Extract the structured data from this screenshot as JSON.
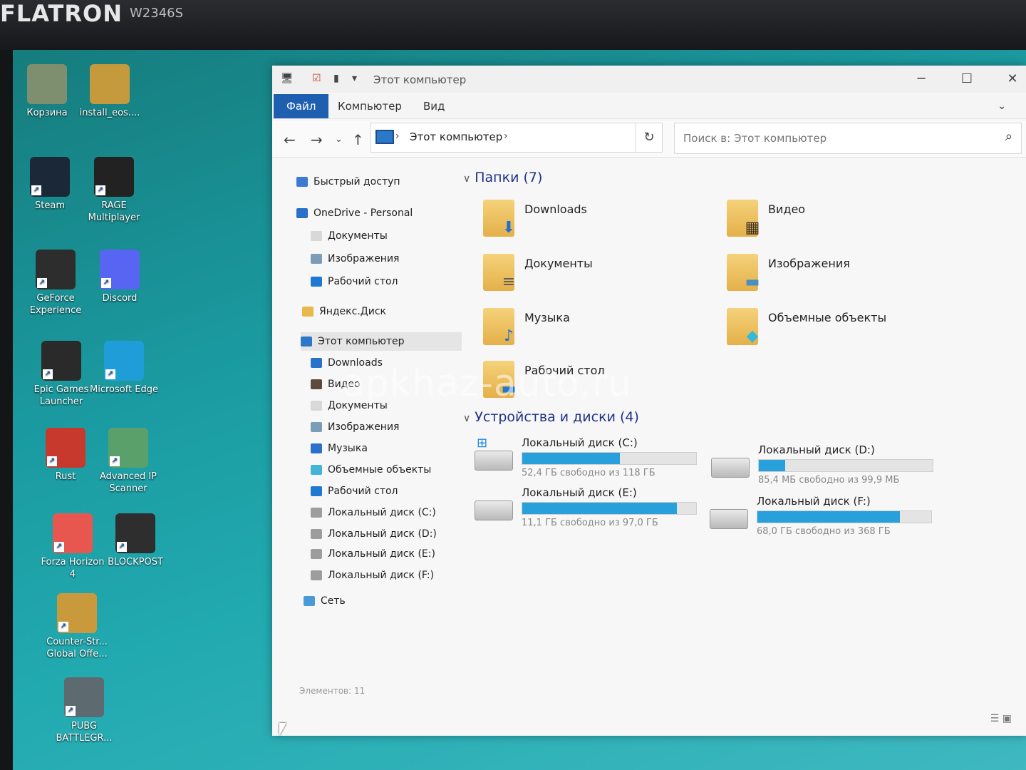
{
  "monitor": {
    "brand": "FLATRON",
    "model": "W2346S"
  },
  "desktop_icons": [
    {
      "label": "Корзина",
      "icon": "recycle-bin-icon",
      "color": "#7e8f6f"
    },
    {
      "label": "install_eos....",
      "icon": "installer-icon",
      "color": "#c59a3c"
    },
    {
      "label": "Steam",
      "icon": "steam-icon",
      "color": "#1b2838"
    },
    {
      "label": "RAGE Multiplayer",
      "icon": "rage-icon",
      "color": "#222222"
    },
    {
      "label": "GeForce Experience",
      "icon": "geforce-icon",
      "color": "#2d2d2d"
    },
    {
      "label": "Discord",
      "icon": "discord-icon",
      "color": "#5865f2"
    },
    {
      "label": "Epic Games Launcher",
      "icon": "epic-icon",
      "color": "#2a2a2a"
    },
    {
      "label": "Microsoft Edge",
      "icon": "edge-icon",
      "color": "#1f9dd9"
    },
    {
      "label": "Rust",
      "icon": "rust-icon",
      "color": "#c7382d"
    },
    {
      "label": "Advanced IP Scanner",
      "icon": "network-icon",
      "color": "#5aa06a"
    },
    {
      "label": "Forza Horizon 4",
      "icon": "forza-icon",
      "color": "#e8574f"
    },
    {
      "label": "BLOCKPOST",
      "icon": "blockpost-icon",
      "color": "#2e2e2e"
    },
    {
      "label": "Counter-Str... Global Offe...",
      "icon": "csgo-icon",
      "color": "#c99a3b"
    },
    {
      "label": "PUBG BATTLEGR...",
      "icon": "pubg-icon",
      "color": "#5d6a70"
    }
  ],
  "window": {
    "title": "Этот компьютер",
    "ribbon_tabs": [
      "Файл",
      "Компьютер",
      "Вид"
    ],
    "address_path": "Этот компьютер",
    "search_placeholder": "Поиск в: Этот компьютер"
  },
  "sidebar": [
    {
      "label": "Быстрый доступ",
      "color": "#3b7bd4"
    },
    {
      "label": "OneDrive - Personal",
      "color": "#2a6fc9"
    },
    {
      "label": "Документы",
      "color": "#d8d8d8"
    },
    {
      "label": "Изображения",
      "color": "#7c9cb7"
    },
    {
      "label": "Рабочий стол",
      "color": "#1f78d1"
    },
    {
      "label": "Яндекс.Диск",
      "color": "#e8b84e"
    },
    {
      "label": "Этот компьютер",
      "color": "#2c78c8"
    },
    {
      "label": "Downloads",
      "color": "#2a72c9"
    },
    {
      "label": "Видео",
      "color": "#5c4a3e"
    },
    {
      "label": "Документы",
      "color": "#d8d8d8"
    },
    {
      "label": "Изображения",
      "color": "#7c9cb7"
    },
    {
      "label": "Музыка",
      "color": "#2a72c9"
    },
    {
      "label": "Объемные объекты",
      "color": "#45b3d8"
    },
    {
      "label": "Рабочий стол",
      "color": "#1f78d1"
    },
    {
      "label": "Локальный диск (C:)",
      "color": "#9d9d9d"
    },
    {
      "label": "Локальный диск (D:)",
      "color": "#9d9d9d"
    },
    {
      "label": "Локальный диск (E:)",
      "color": "#9d9d9d"
    },
    {
      "label": "Локальный диск (F:)",
      "color": "#9d9d9d"
    },
    {
      "label": "Сеть",
      "color": "#4a9ad8"
    }
  ],
  "groups": {
    "folders": "Папки (7)",
    "devices": "Устройства и диски (4)"
  },
  "folders": [
    {
      "name": "Downloads",
      "overlay": "⬇",
      "overlay_color": "#1f6fd1"
    },
    {
      "name": "Видео",
      "overlay": "▦",
      "overlay_color": "#3a2d1f"
    },
    {
      "name": "Документы",
      "overlay": "≡",
      "overlay_color": "#555555"
    },
    {
      "name": "Изображения",
      "overlay": "▬",
      "overlay_color": "#4a8fbf"
    },
    {
      "name": "Музыка",
      "overlay": "♪",
      "overlay_color": "#1f6fd1"
    },
    {
      "name": "Объемные объекты",
      "overlay": "◆",
      "overlay_color": "#36b7dc"
    },
    {
      "name": "Рабочий стол",
      "overlay": "▬",
      "overlay_color": "#1f78d1"
    }
  ],
  "drives": [
    {
      "name": "Локальный диск (C:)",
      "free": "52,4 ГБ свободно из 118 ГБ",
      "used_fraction": 0.56,
      "system": true
    },
    {
      "name": "Локальный диск (D:)",
      "free": "85,4 МБ свободно из 99,9 МБ",
      "used_fraction": 0.15,
      "system": false
    },
    {
      "name": "Локальный диск (E:)",
      "free": "11,1 ГБ свободно из 97,0 ГБ",
      "used_fraction": 0.89,
      "system": false
    },
    {
      "name": "Локальный диск (F:)",
      "free": "68,0 ГБ свободно из 368 ГБ",
      "used_fraction": 0.82,
      "system": false
    }
  ],
  "status": "Элементов: 11",
  "watermark": "apkhaz-auto.ru"
}
